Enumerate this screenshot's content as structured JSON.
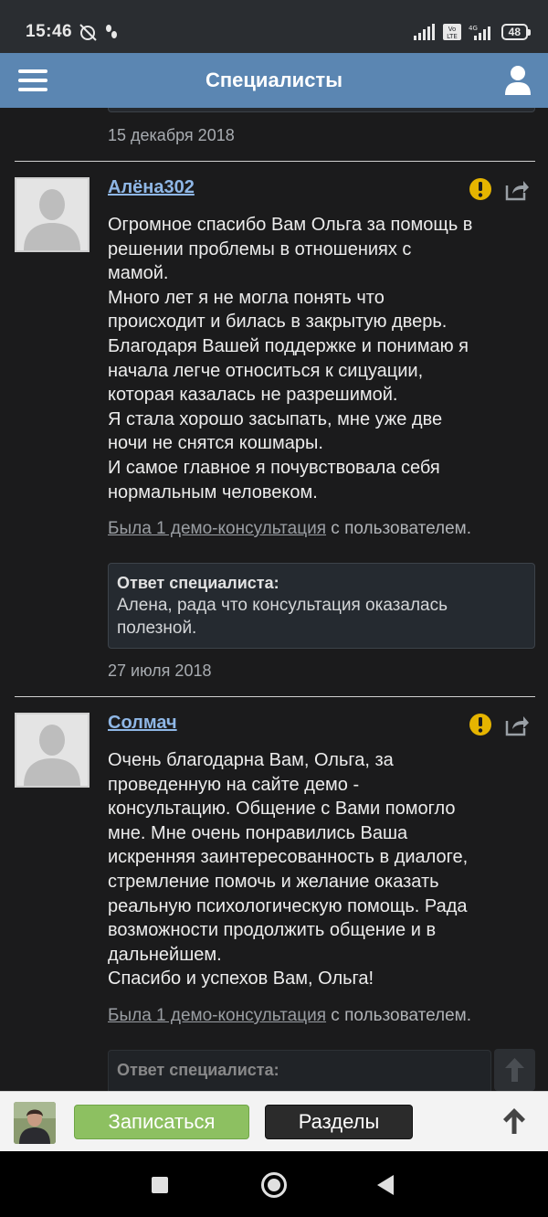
{
  "status_bar": {
    "time": "15:46",
    "battery": "48",
    "icons_left": [
      "alarm-off-icon",
      "steps-icon"
    ],
    "icons_right": [
      "signal-icon",
      "volte-icon",
      "signal-4g-icon",
      "battery-icon"
    ]
  },
  "header": {
    "title": "Специалисты",
    "menu_icon": "hamburger-menu-icon",
    "user_icon": "user-profile-icon"
  },
  "prev_review": {
    "date": "15 декабря 2018"
  },
  "reviews": [
    {
      "author": "Алёна302",
      "lines": [
        "Огромное спасибо Вам Ольга за помощь в",
        "решении проблемы в отношениях с",
        "мамой.",
        "Много лет я не могла понять что",
        "происходит и билась в закрытую дверь.",
        "Благодаря Вашей поддержке и понимаю я",
        "начала легче относиться к сицуации,",
        "которая казалась не разрешимой.",
        "Я стала хорошо засыпать, мне уже две",
        "ночи не снятся кошмары.",
        "И самое главное я почувствовала себя",
        "нормальным человеком."
      ],
      "demo_link": "Была 1 демо-консультация",
      "demo_suffix": " с пользователем.",
      "answer_title": "Ответ специалиста:",
      "answer_lines": [
        "Алена, рада что консультация оказалась",
        "полезной."
      ],
      "date": "27 июля 2018"
    },
    {
      "author": "Солмач",
      "lines": [
        "Очень благодарна Вам, Ольга, за",
        "проведенную на сайте демо -",
        "консультацию. Общение с Вами помогло",
        "мне. Мне очень понравились Ваша",
        "искренняя заинтересованность в диалоге,",
        "стремление помочь и желание оказать",
        "реальную психологическую помощь. Рада",
        "возможности продолжить общение и в",
        "дальнейшем.",
        "Спасибо и успехов Вам, Ольга!"
      ],
      "demo_link": "Была 1 демо-консультация",
      "demo_suffix": " с пользователем.",
      "answer_title": "Ответ специалиста:"
    }
  ],
  "bottom_bar": {
    "signup_label": "Записаться",
    "sections_label": "Разделы"
  },
  "colors": {
    "app_bar": "#5b86b2",
    "signup_button": "#8dc061",
    "link": "#8fb7e6",
    "warning": "#e5b400"
  }
}
